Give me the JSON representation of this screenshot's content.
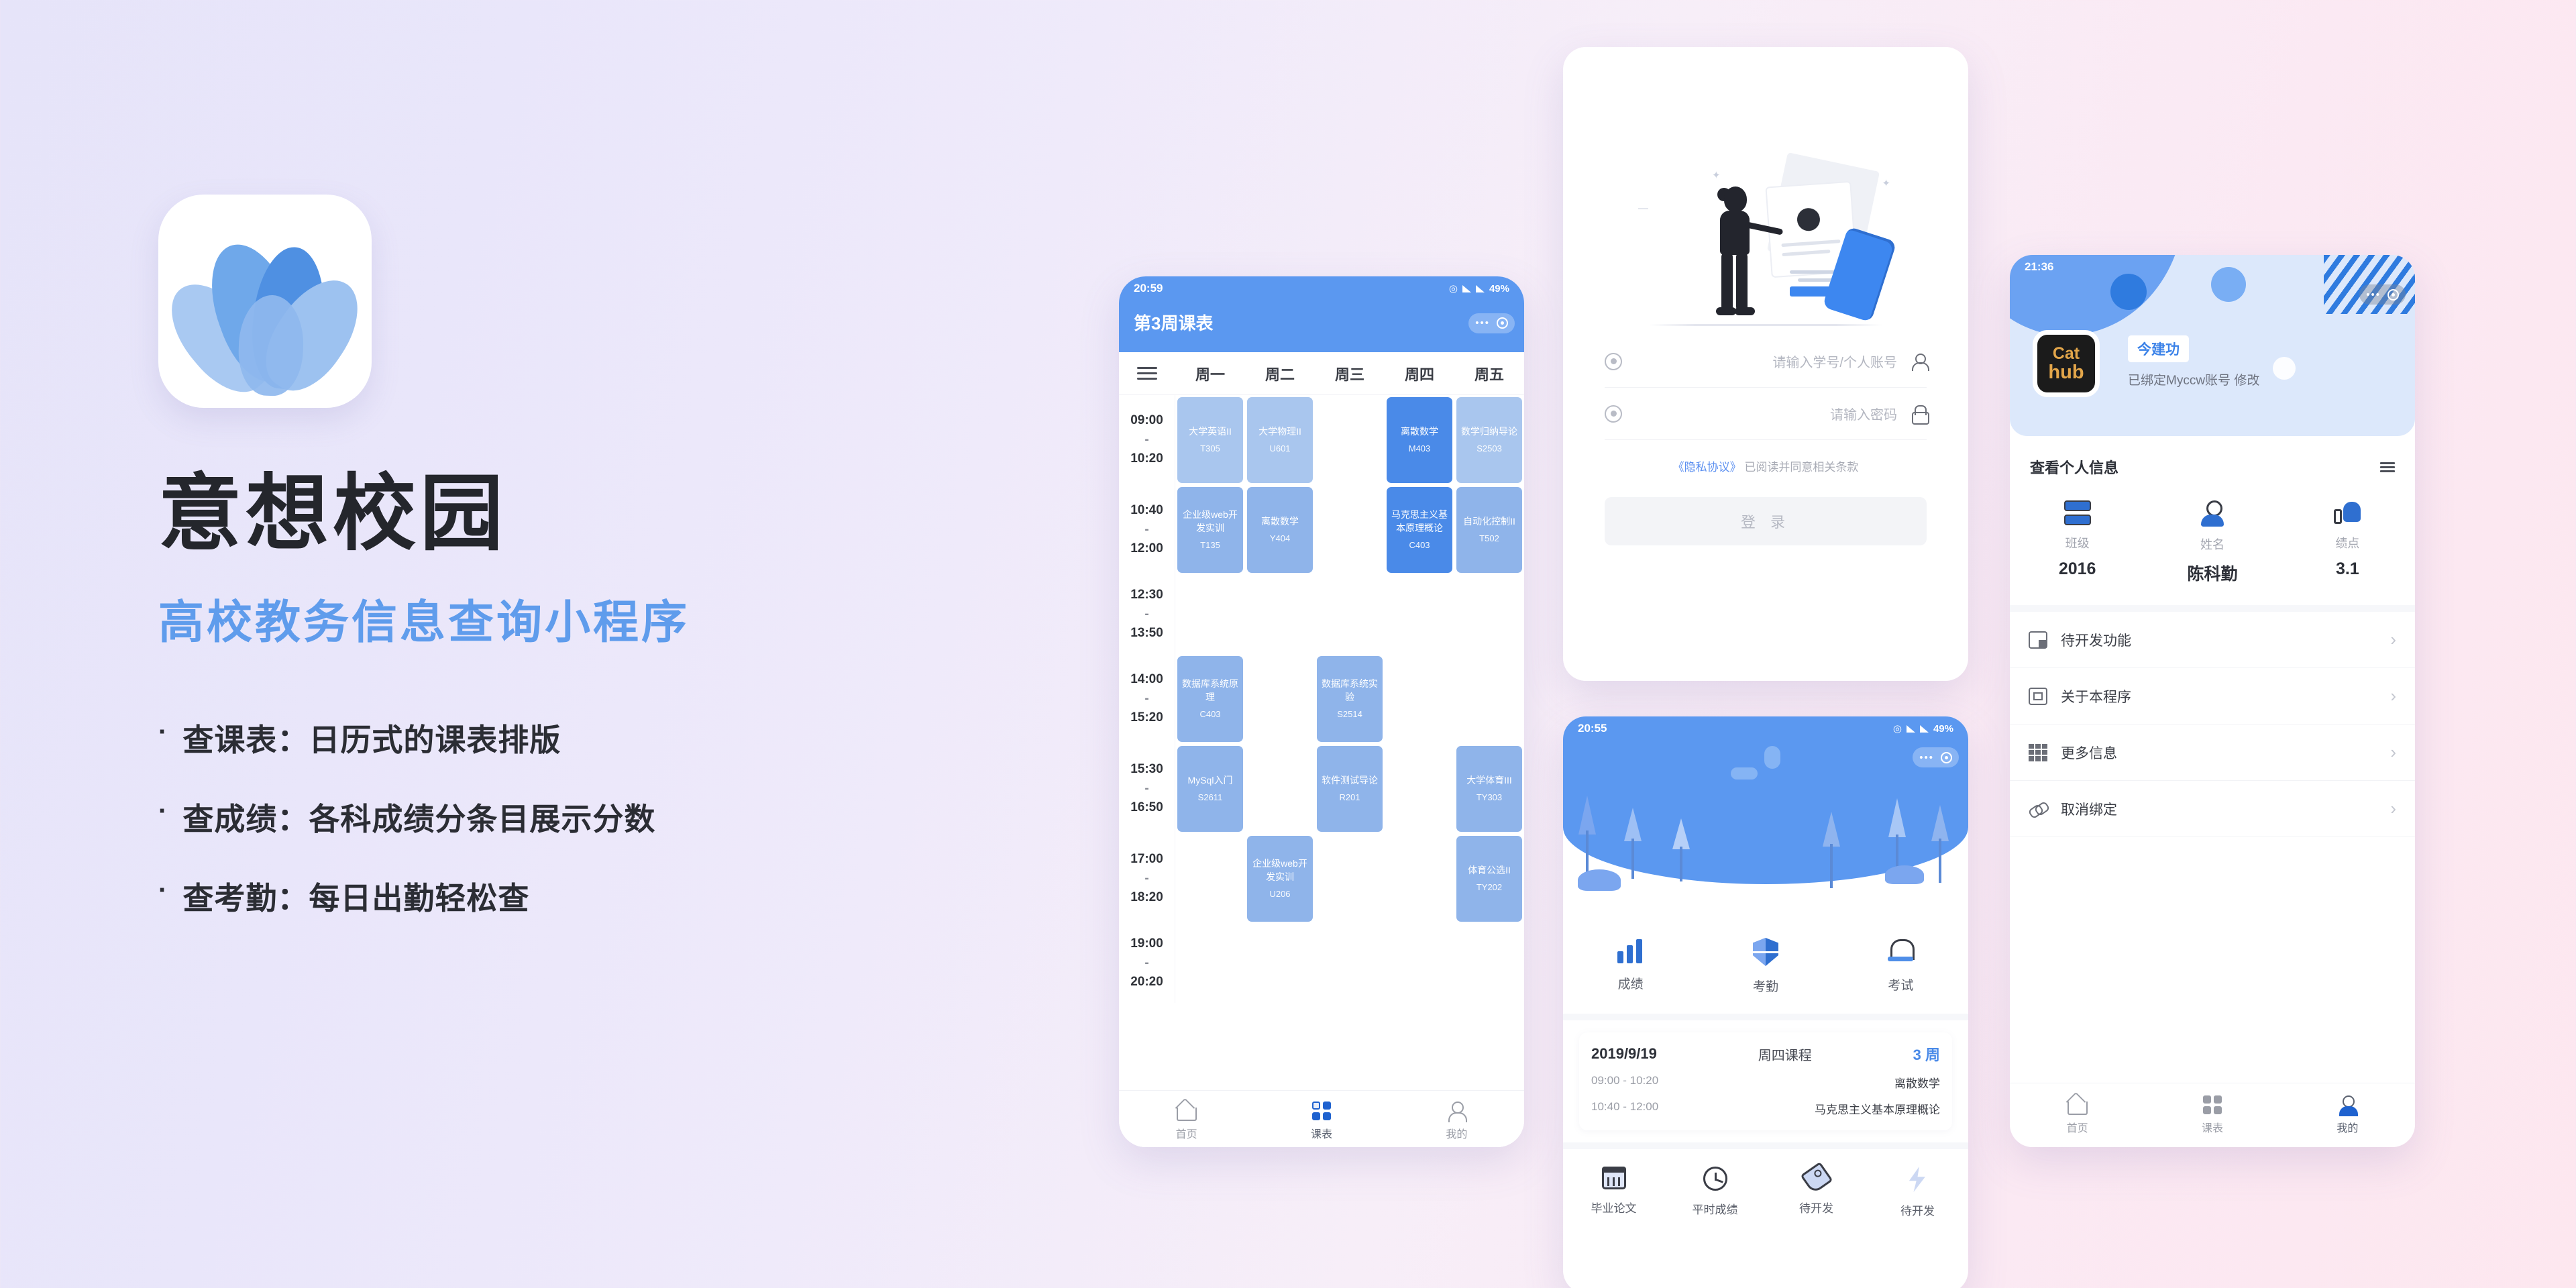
{
  "promo": {
    "title": "意想校园",
    "subtitle": "高校教务信息查询小程序",
    "bullet_marker": "·",
    "features": [
      "查课表：日历式的课表排版",
      "查成绩：各科成绩分条目展示分数",
      "查考勤：每日出勤轻松查"
    ]
  },
  "schedule_screen": {
    "status_time": "20:59",
    "status_battery": "49%",
    "title": "第3周课表",
    "menu_icon": "hamburger-icon",
    "days": [
      "周一",
      "周二",
      "周三",
      "周四",
      "周五"
    ],
    "timeslots": [
      {
        "start": "09:00",
        "end": "10:20"
      },
      {
        "start": "10:40",
        "end": "12:00"
      },
      {
        "start": "12:30",
        "end": "13:50"
      },
      {
        "start": "14:00",
        "end": "15:20"
      },
      {
        "start": "15:30",
        "end": "16:50"
      },
      {
        "start": "17:00",
        "end": "18:20"
      },
      {
        "start": "19:00",
        "end": "20:20"
      }
    ],
    "courses": [
      {
        "row": 0,
        "col": 0,
        "name": "大学英语II",
        "room": "T305",
        "tone": "lt"
      },
      {
        "row": 0,
        "col": 1,
        "name": "大学物理II",
        "room": "U601",
        "tone": "lt"
      },
      {
        "row": 0,
        "col": 3,
        "name": "离散数学",
        "room": "M403",
        "tone": "dk"
      },
      {
        "row": 0,
        "col": 4,
        "name": "数学归纳导论",
        "room": "S2503",
        "tone": "lt"
      },
      {
        "row": 1,
        "col": 0,
        "name": "企业级web开发实训",
        "room": "T135",
        "tone": "md"
      },
      {
        "row": 1,
        "col": 1,
        "name": "离散数学",
        "room": "Y404",
        "tone": "md"
      },
      {
        "row": 1,
        "col": 3,
        "name": "马克思主义基本原理概论",
        "room": "C403",
        "tone": "dk"
      },
      {
        "row": 1,
        "col": 4,
        "name": "自动化控制II",
        "room": "T502",
        "tone": "md"
      },
      {
        "row": 3,
        "col": 0,
        "name": "数据库系统原理",
        "room": "C403",
        "tone": "md"
      },
      {
        "row": 3,
        "col": 2,
        "name": "数据库系统实验",
        "room": "S2514",
        "tone": "md"
      },
      {
        "row": 4,
        "col": 0,
        "name": "MySql入门",
        "room": "S2611",
        "tone": "md"
      },
      {
        "row": 4,
        "col": 2,
        "name": "软件测试导论",
        "room": "R201",
        "tone": "md"
      },
      {
        "row": 4,
        "col": 4,
        "name": "大学体育III",
        "room": "TY303",
        "tone": "md"
      },
      {
        "row": 5,
        "col": 1,
        "name": "企业级web开发实训",
        "room": "U206",
        "tone": "md"
      },
      {
        "row": 5,
        "col": 4,
        "name": "体育公选II",
        "room": "TY202",
        "tone": "md"
      }
    ],
    "tabs": [
      {
        "label": "首页",
        "icon": "home-icon",
        "active": false
      },
      {
        "label": "课表",
        "icon": "grid-icon",
        "active": true
      },
      {
        "label": "我的",
        "icon": "user-icon",
        "active": false
      }
    ]
  },
  "login_screen": {
    "illustration": "person-with-phone-illustration",
    "username": {
      "placeholder": "请输入学号/个人账号",
      "icon": "person-icon"
    },
    "password": {
      "placeholder": "请输入密码",
      "icon": "lock-icon"
    },
    "agreement_link": "《隐私协议》",
    "agreement_text": "已阅读并同意相关条款",
    "submit_label": "登 录"
  },
  "home_screen": {
    "status_time": "20:55",
    "status_battery": "49%",
    "features": [
      {
        "label": "成绩",
        "icon": "bar-chart-icon"
      },
      {
        "label": "考勤",
        "icon": "shield-icon"
      },
      {
        "label": "考试",
        "icon": "bell-icon"
      }
    ],
    "today": {
      "date": "2019/9/19",
      "dayname": "周四课程",
      "week": "3 周",
      "classes": [
        {
          "time": "09:00 - 10:20",
          "name": "离散数学"
        },
        {
          "time": "10:40 - 12:00",
          "name": "马克思主义基本原理概论"
        }
      ]
    },
    "quick_actions": [
      {
        "label": "毕业论文",
        "icon": "calendar-icon"
      },
      {
        "label": "平时成绩",
        "icon": "clock-icon"
      },
      {
        "label": "待开发",
        "icon": "tag-icon"
      },
      {
        "label": "待开发",
        "icon": "bolt-icon"
      }
    ]
  },
  "profile_screen": {
    "status_time": "21:36",
    "avatar_line1": "Cat",
    "avatar_line2": "hub",
    "badge": "今建功",
    "nickname": "已绑定Myccw账号 修改",
    "info_header": "查看个人信息",
    "menu_icon": "hamburger-icon",
    "stats": [
      {
        "label": "班级",
        "value": "2016",
        "icon": "class-icon"
      },
      {
        "label": "姓名",
        "value": "陈科勤",
        "icon": "person-icon"
      },
      {
        "label": "绩点",
        "value": "3.1",
        "icon": "thumb-up-icon"
      }
    ],
    "menu": [
      {
        "label": "待开发功能",
        "icon": "dev-icon",
        "chevron": "›"
      },
      {
        "label": "关于本程序",
        "icon": "about-icon",
        "chevron": "›"
      },
      {
        "label": "更多信息",
        "icon": "more-icon",
        "chevron": "›"
      },
      {
        "label": "取消绑定",
        "icon": "link-icon",
        "chevron": "›"
      }
    ],
    "tabs": [
      {
        "label": "首页",
        "icon": "home-icon",
        "active": false
      },
      {
        "label": "课表",
        "icon": "grid-icon",
        "active": false
      },
      {
        "label": "我的",
        "icon": "user-icon",
        "active": true
      }
    ]
  },
  "colors": {
    "brand_blue": "#5b98f0",
    "accent_blue": "#4a8ae8",
    "subtitle_blue": "#5f9cec",
    "bg_left": "#e6e4f9",
    "bg_right": "#fde7ef"
  }
}
